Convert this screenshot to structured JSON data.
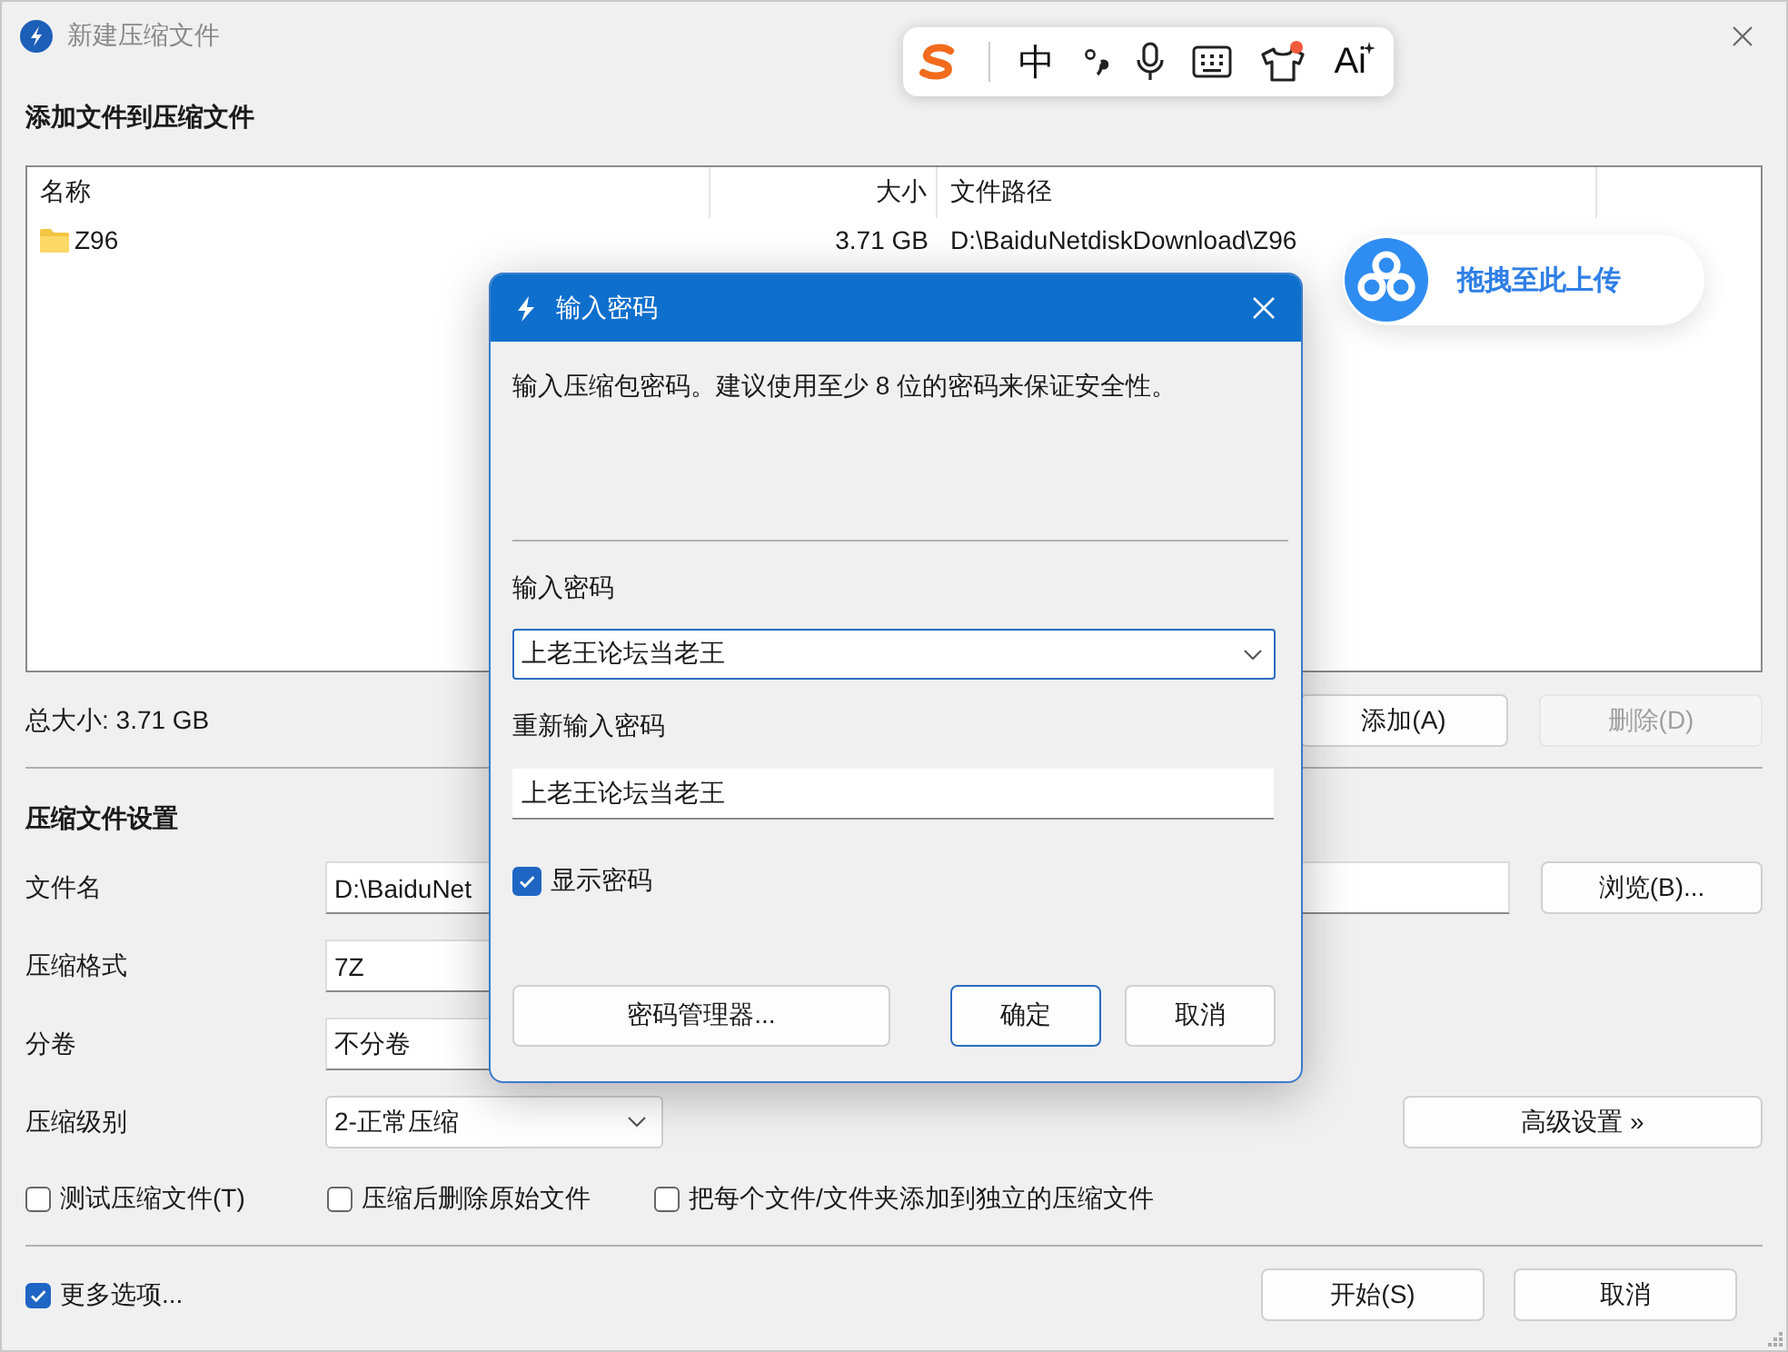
{
  "window": {
    "title": "新建压缩文件",
    "active": false
  },
  "files": {
    "heading": "添加文件到压缩文件",
    "columns": [
      "名称",
      "大小",
      "文件路径"
    ],
    "rows": [
      {
        "kind": "folder",
        "name": "Z96",
        "size": "3.71 GB",
        "path": "D:\\BaiduNetdiskDownload\\Z96"
      }
    ],
    "total": "总大小: 3.71 GB",
    "buttons": [
      {
        "label": "添加(A)",
        "disabled": false
      },
      {
        "label": "删除(D)",
        "disabled": true
      }
    ]
  },
  "settings": {
    "heading": "压缩文件设置",
    "fields": [
      {
        "label": "文件名",
        "value": "D:\\BaiduNet",
        "kind": "text"
      },
      {
        "label": "压缩格式",
        "value": "7Z",
        "kind": "text"
      },
      {
        "label": "分卷",
        "value": "不分卷",
        "kind": "text"
      },
      {
        "label": "压缩级别",
        "value": "2-正常压缩",
        "kind": "dropdown"
      }
    ],
    "browse_button": "浏览(B)...",
    "advanced_button": "高级设置 »",
    "options": [
      {
        "label": "测试压缩文件(T)",
        "checked": false
      },
      {
        "label": "压缩后删除原始文件",
        "checked": false
      },
      {
        "label": "把每个文件/文件夹添加到独立的压缩文件",
        "checked": false
      }
    ]
  },
  "footer": {
    "more_options": {
      "label": "更多选项...",
      "checked": true
    },
    "buttons": [
      "开始(S)",
      "取消"
    ]
  },
  "password_dialog": {
    "title": "输入密码",
    "message": "输入压缩包密码。建议使用至少 8 位的密码来保证安全性。",
    "password_label": "输入密码",
    "password": "上老王论坛当老王",
    "confirm_label": "重新输入密码",
    "confirm": "上老王论坛当老王",
    "show_password": {
      "label": "显示密码",
      "checked": true
    },
    "manager_button": "密码管理器...",
    "buttons": [
      {
        "label": "确定",
        "default": true
      },
      {
        "label": "取消",
        "default": false
      }
    ]
  },
  "ime_toolbar": {
    "items": [
      {
        "kind": "logo"
      },
      {
        "kind": "text",
        "text": "中"
      },
      {
        "kind": "punctuation"
      },
      {
        "kind": "mic"
      },
      {
        "kind": "keyboard"
      },
      {
        "kind": "skin"
      },
      {
        "kind": "ai",
        "text": "Ai"
      }
    ]
  },
  "upload_badge": {
    "text": "拖拽至此上传"
  }
}
